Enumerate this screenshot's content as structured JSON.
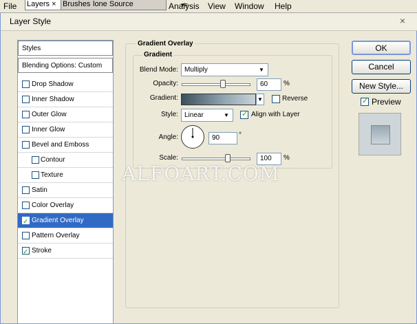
{
  "menubar": {
    "file": "File",
    "tabs": [
      "Layers",
      "Brushes",
      "lone Source"
    ],
    "tab_close": "×",
    "panel_menu": "▾≡",
    "items": [
      "Analysis",
      "View",
      "Window",
      "Help"
    ]
  },
  "dialog": {
    "title": "Layer Style",
    "close": "×"
  },
  "stylelist": {
    "header": "Styles",
    "blending": "Blending Options: Custom",
    "items": [
      {
        "label": "Drop Shadow",
        "checked": false,
        "sub": false
      },
      {
        "label": "Inner Shadow",
        "checked": false,
        "sub": false
      },
      {
        "label": "Outer Glow",
        "checked": false,
        "sub": false
      },
      {
        "label": "Inner Glow",
        "checked": false,
        "sub": false
      },
      {
        "label": "Bevel and Emboss",
        "checked": false,
        "sub": false
      },
      {
        "label": "Contour",
        "checked": false,
        "sub": true
      },
      {
        "label": "Texture",
        "checked": false,
        "sub": true
      },
      {
        "label": "Satin",
        "checked": false,
        "sub": false
      },
      {
        "label": "Color Overlay",
        "checked": false,
        "sub": false
      },
      {
        "label": "Gradient Overlay",
        "checked": true,
        "sub": false,
        "selected": true
      },
      {
        "label": "Pattern Overlay",
        "checked": false,
        "sub": false
      },
      {
        "label": "Stroke",
        "checked": true,
        "sub": false
      }
    ]
  },
  "settings": {
    "section_title": "Gradient Overlay",
    "group_title": "Gradient",
    "blend_mode_label": "Blend Mode:",
    "blend_mode_value": "Multiply",
    "opacity_label": "Opacity:",
    "opacity_value": "60",
    "opacity_unit": "%",
    "opacity_level": 0.6,
    "gradient_label": "Gradient:",
    "reverse_label": "Reverse",
    "reverse_checked": false,
    "style_label": "Style:",
    "style_value": "Linear",
    "align_label": "Align with Layer",
    "align_checked": true,
    "angle_label": "Angle:",
    "angle_value": "90",
    "angle_unit": "°",
    "scale_label": "Scale:",
    "scale_value": "100",
    "scale_unit": "%",
    "scale_level": 0.67
  },
  "buttons": {
    "ok": "OK",
    "cancel": "Cancel",
    "new_style": "New Style...",
    "preview_label": "Preview",
    "preview_checked": true
  },
  "watermark": "ALFOART.COM"
}
